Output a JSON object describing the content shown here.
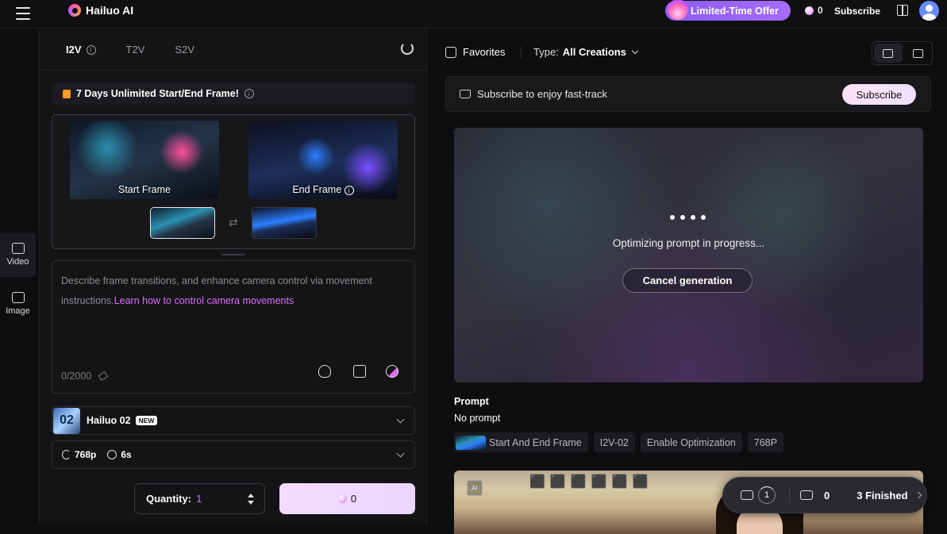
{
  "header": {
    "brand": "Hailuo AI",
    "offer_label": "Limited-Time Offer",
    "credits": "0",
    "subscribe_label": "Subscribe"
  },
  "nav": {
    "items": [
      {
        "label": "Video",
        "icon": "video-icon",
        "active": true
      },
      {
        "label": "Image",
        "icon": "image-icon",
        "active": false
      }
    ]
  },
  "panel": {
    "tabs": [
      {
        "label": "I2V",
        "active": true
      },
      {
        "label": "T2V",
        "active": false
      },
      {
        "label": "S2V",
        "active": false
      }
    ],
    "promo": "7 Days Unlimited Start/End Frame!",
    "start_frame_label": "Start Frame",
    "end_frame_label": "End Frame",
    "prompt_placeholder": "Describe frame transitions, and enhance camera control via movement instructions.",
    "prompt_link": "Learn how to control camera movements",
    "char_count": "0/2000",
    "model_thumb_text": "02",
    "model_name": "Hailuo 02",
    "model_badge": "NEW",
    "resolution": "768p",
    "duration": "6s",
    "quantity_label": "Quantity:",
    "quantity_value": "1",
    "generate_cost": "0"
  },
  "results": {
    "favorites_label": "Favorites",
    "type_label": "Type:",
    "type_value": "All Creations",
    "fast_track_text": "Subscribe to enjoy fast-track",
    "fast_track_button": "Subscribe",
    "progress_text": "Optimizing prompt in progress...",
    "cancel_label": "Cancel generation",
    "prompt_heading": "Prompt",
    "prompt_value": "No prompt",
    "tags": [
      "Start And End Frame",
      "I2V-02",
      "Enable Optimization",
      "768P"
    ],
    "ai_badge": "AI",
    "queue": {
      "running": "1",
      "pending": "0",
      "finished": "3 Finished"
    }
  },
  "colors": {
    "accent": "#e06bff",
    "offer": "#8b5cf6",
    "background": "#0e0e10"
  }
}
